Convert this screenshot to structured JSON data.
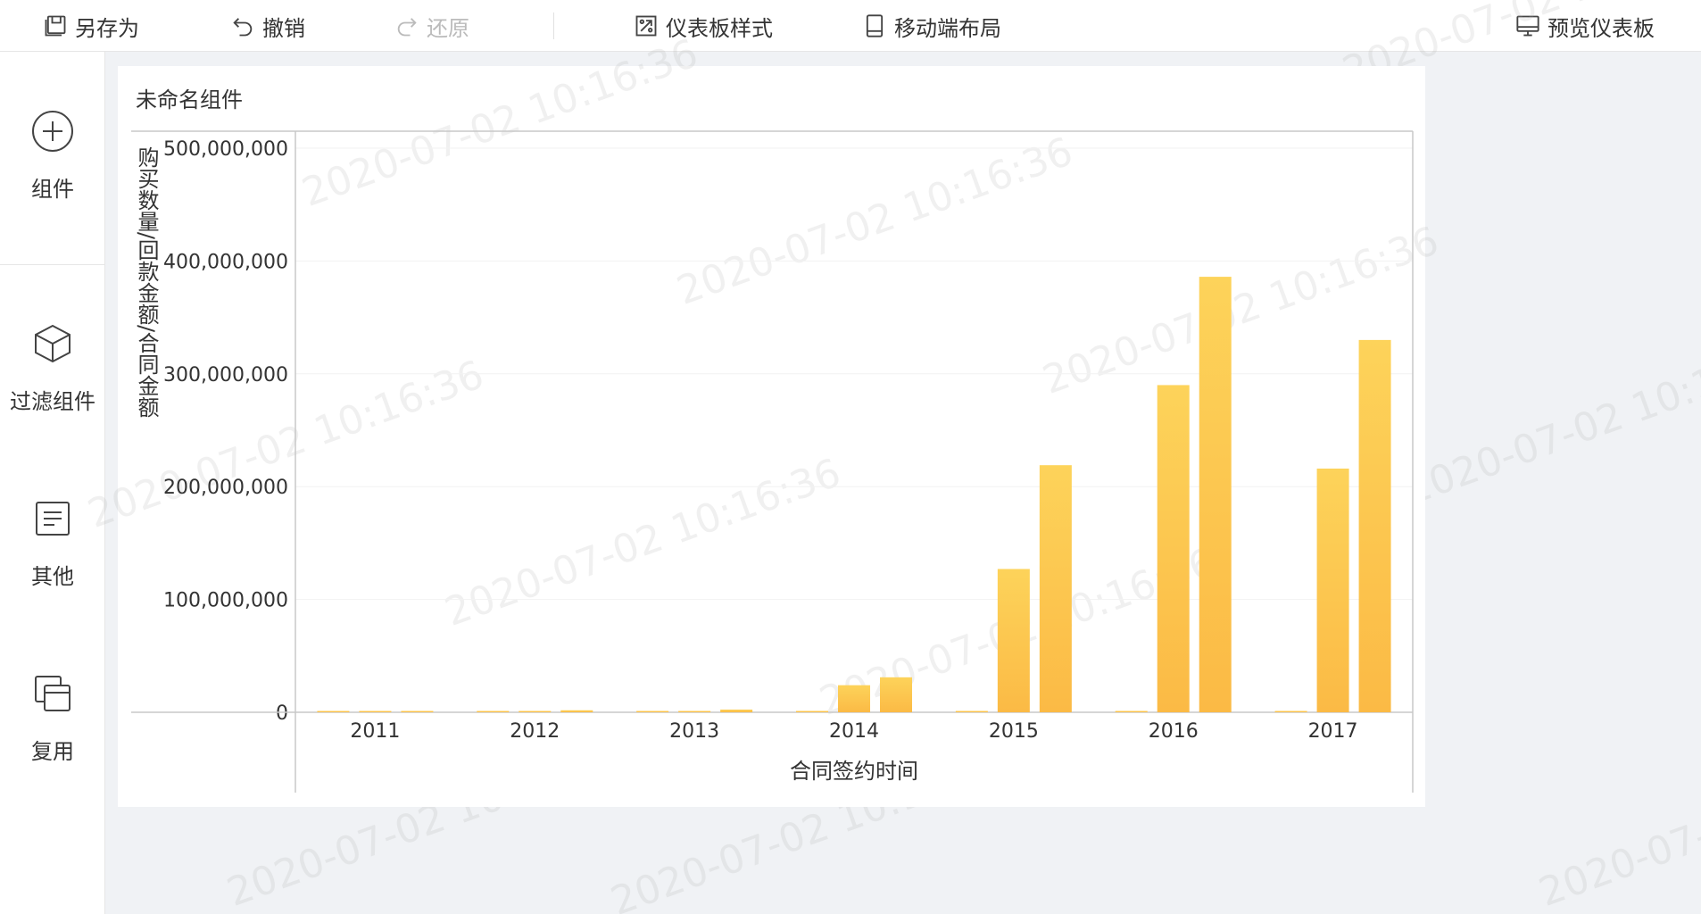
{
  "toolbar": {
    "save_as": "另存为",
    "undo": "撤销",
    "redo": "还原",
    "dashboard_style": "仪表板样式",
    "mobile_layout": "移动端布局",
    "preview": "预览仪表板"
  },
  "sidebar": {
    "items": [
      {
        "label": "组件",
        "icon": "plus-circle-icon"
      },
      {
        "label": "过滤组件",
        "icon": "cube-icon"
      },
      {
        "label": "其他",
        "icon": "document-icon"
      },
      {
        "label": "复用",
        "icon": "copy-icon"
      }
    ]
  },
  "widget": {
    "title": "未命名组件"
  },
  "watermark": "2020-07-02 10:16:36",
  "chart_data": {
    "type": "bar",
    "categories": [
      "2011",
      "2012",
      "2013",
      "2014",
      "2015",
      "2016",
      "2017"
    ],
    "series": [
      {
        "values": [
          0,
          0,
          0,
          0,
          0,
          0,
          0
        ]
      },
      {
        "values": [
          400000,
          500000,
          400000,
          24000000,
          127000000,
          290000000,
          216000000
        ]
      },
      {
        "values": [
          500000,
          1800000,
          2400000,
          31000000,
          219000000,
          386000000,
          330000000
        ]
      }
    ],
    "xlabel": "合同签约时间",
    "ylabel": "购买数量/回款金额/合同金额",
    "ylim": [
      0,
      500000000
    ],
    "yticks": [
      "0",
      "100,000,000",
      "200,000,000",
      "300,000,000",
      "400,000,000",
      "500,000,000"
    ],
    "colors": {
      "bar_top": "#FDD35A",
      "bar_bottom": "#FBBA45",
      "axis": "#c8c8c8",
      "grid": "#f2f2f2"
    },
    "legend": false,
    "grid": true
  }
}
